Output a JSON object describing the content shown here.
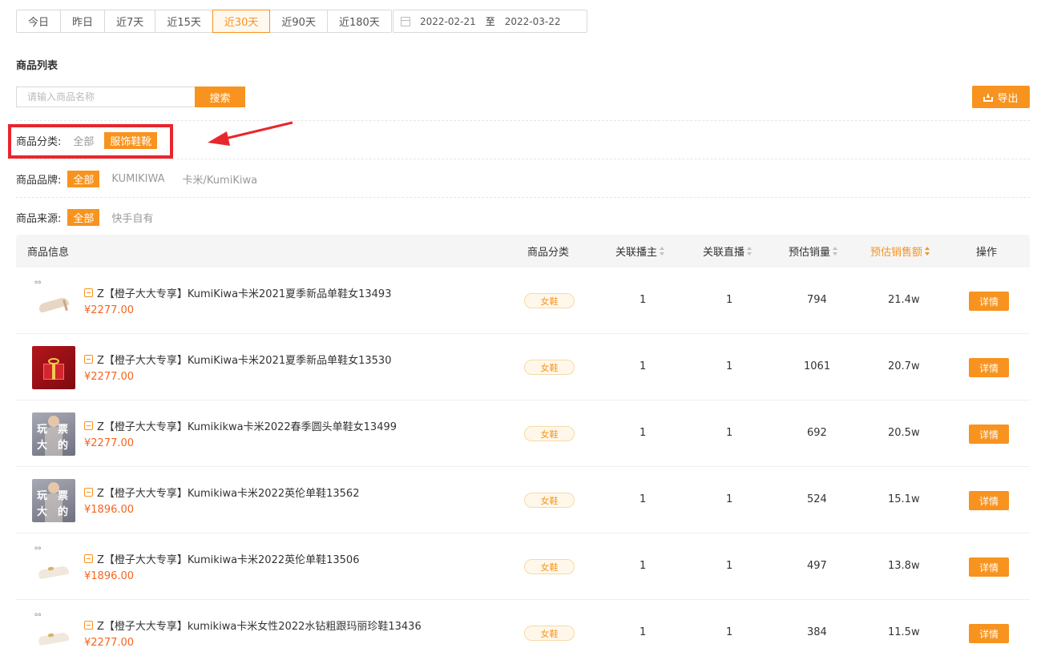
{
  "date_tabs": [
    {
      "label": "今日",
      "active": false
    },
    {
      "label": "昨日",
      "active": false
    },
    {
      "label": "近7天",
      "active": false
    },
    {
      "label": "近15天",
      "active": false
    },
    {
      "label": "近30天",
      "active": true
    },
    {
      "label": "近90天",
      "active": false
    },
    {
      "label": "近180天",
      "active": false
    }
  ],
  "date_range": {
    "start": "2022-02-21",
    "separator": "至",
    "end": "2022-03-22",
    "icon": "calendar-icon"
  },
  "section_title": "商品列表",
  "search": {
    "placeholder": "请输入商品名称",
    "button": "搜索"
  },
  "export": {
    "label": "导出",
    "icon": "upload-icon"
  },
  "filters": {
    "category": {
      "label": "商品分类:",
      "options": [
        {
          "label": "全部",
          "active": false
        },
        {
          "label": "服饰鞋靴",
          "active": true
        }
      ]
    },
    "brand": {
      "label": "商品品牌:",
      "options": [
        {
          "label": "全部",
          "active": true
        },
        {
          "label": "KUMIKIWA",
          "active": false
        },
        {
          "label": "卡米/KumiKiwa",
          "active": false
        }
      ]
    },
    "source": {
      "label": "商品来源:",
      "options": [
        {
          "label": "全部",
          "active": true
        },
        {
          "label": "快手自有",
          "active": false
        }
      ]
    }
  },
  "table": {
    "headers": {
      "info": "商品信息",
      "category": "商品分类",
      "anchors": "关联播主",
      "lives": "关联直播",
      "sales": "预估销量",
      "revenue": "预估销售额",
      "action": "操作"
    },
    "sorted_column": "revenue",
    "rows": [
      {
        "thumb": "shoe-heel",
        "title": "Z【橙子大大专享】KumiKiwa卡米2021夏季新品单鞋女13493",
        "price": "¥2277.00",
        "category": "女鞋",
        "anchors": "1",
        "lives": "1",
        "sales": "794",
        "revenue": "21.4w",
        "action": "详情"
      },
      {
        "thumb": "gift",
        "title": "Z【橙子大大专享】KumiKiwa卡米2021夏季新品单鞋女13530",
        "price": "¥2277.00",
        "category": "女鞋",
        "anchors": "1",
        "lives": "1",
        "sales": "1061",
        "revenue": "20.7w",
        "action": "详情"
      },
      {
        "thumb": "promo",
        "thumb_text": [
          "玩",
          "票",
          "大",
          "的"
        ],
        "title": "Z【橙子大大专享】Kumikikwa卡米2022春季圆头单鞋女13499",
        "price": "¥2277.00",
        "category": "女鞋",
        "anchors": "1",
        "lives": "1",
        "sales": "692",
        "revenue": "20.5w",
        "action": "详情"
      },
      {
        "thumb": "promo",
        "thumb_text": [
          "玩",
          "票",
          "大",
          "的"
        ],
        "title": "Z【橙子大大专享】Kumikiwa卡米2022英伦单鞋13562",
        "price": "¥1896.00",
        "category": "女鞋",
        "anchors": "1",
        "lives": "1",
        "sales": "524",
        "revenue": "15.1w",
        "action": "详情"
      },
      {
        "thumb": "shoe-flat",
        "title": "Z【橙子大大专享】Kumikiwa卡米2022英伦单鞋13506",
        "price": "¥1896.00",
        "category": "女鞋",
        "anchors": "1",
        "lives": "1",
        "sales": "497",
        "revenue": "13.8w",
        "action": "详情"
      },
      {
        "thumb": "shoe-flat",
        "title": "Z【橙子大大专享】kumikiwa卡米女性2022水钻粗跟玛丽珍鞋13436",
        "price": "¥2277.00",
        "category": "女鞋",
        "anchors": "1",
        "lives": "1",
        "sales": "384",
        "revenue": "11.5w",
        "action": "详情"
      }
    ]
  },
  "colors": {
    "accent": "#f7931e",
    "price": "#f7641e",
    "annotation": "#e8262d"
  }
}
